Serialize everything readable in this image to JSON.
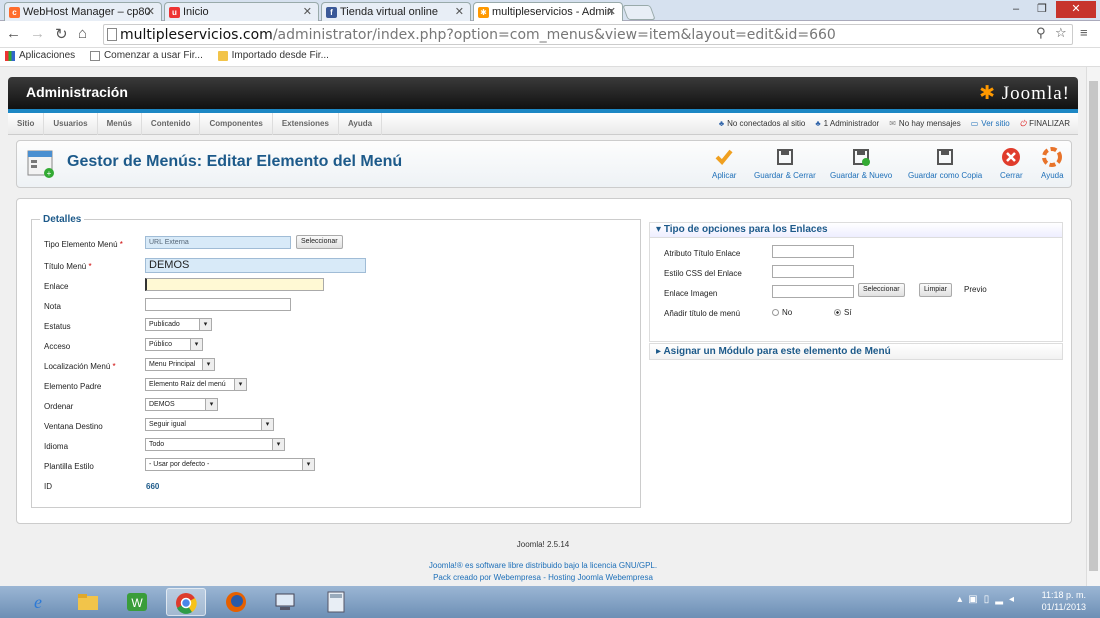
{
  "browser": {
    "tabs": [
      {
        "label": "WebHost Manager – cp80",
        "icon": "cpanel-icon"
      },
      {
        "label": "Inicio",
        "icon": "home-favicon"
      },
      {
        "label": "Tienda virtual online",
        "icon": "facebook-icon"
      },
      {
        "label": "multipleservicios - Admin",
        "icon": "joomla-icon",
        "active": true
      }
    ],
    "url_host": "multipleservicios.com",
    "url_path": "/administrator/index.php?option=com_menus&view=item&layout=edit&id=660",
    "bookmarks": [
      "Aplicaciones",
      "Comenzar a usar Fir...",
      "Importado desde Fir..."
    ]
  },
  "admin": {
    "header_title": "Administración",
    "brand": "Joomla!",
    "menu": [
      "Sitio",
      "Usuarios",
      "Menús",
      "Contenido",
      "Componentes",
      "Extensiones",
      "Ayuda"
    ],
    "status": {
      "visitors": "No conectados al sitio",
      "admins": "1 Administrador",
      "messages": "No hay mensajes",
      "view_site": "Ver sitio",
      "logout": "FINALIZAR"
    }
  },
  "toolbar": {
    "page_title": "Gestor de Menús: Editar Elemento del Menú",
    "buttons": [
      "Aplicar",
      "Guardar & Cerrar",
      "Guardar & Nuevo",
      "Guardar como Copia",
      "Cerrar",
      "Ayuda"
    ]
  },
  "form": {
    "legend": "Detalles",
    "fields": {
      "tipo_label": "Tipo Elemento Menú",
      "tipo_value": "URL Externa",
      "tipo_button": "Seleccionar",
      "titulo_label": "Título Menú",
      "titulo_value": "DEMOS",
      "enlace_label": "Enlace",
      "enlace_value": "",
      "nota_label": "Nota",
      "nota_value": "",
      "estatus_label": "Estatus",
      "estatus_value": "Publicado",
      "acceso_label": "Acceso",
      "acceso_value": "Público",
      "localizacion_label": "Localización Menú",
      "localizacion_value": "Menu Principal",
      "padre_label": "Elemento Padre",
      "padre_value": "Elemento Raíz del menú",
      "ordenar_label": "Ordenar",
      "ordenar_value": "DEMOS",
      "ventana_label": "Ventana Destino",
      "ventana_value": "Seguir igual",
      "idioma_label": "Idioma",
      "idioma_value": "Todo",
      "plantilla_label": "Plantilla Estilo",
      "plantilla_value": "- Usar por defecto -",
      "id_label": "ID",
      "id_value": "660"
    }
  },
  "link_options": {
    "header": "Tipo de opciones para los Enlaces",
    "atributo_label": "Atributo Título Enlace",
    "css_label": "Estilo CSS del Enlace",
    "imagen_label": "Enlace Imagen",
    "seleccionar": "Seleccionar",
    "limpiar": "Limpiar",
    "previo": "Previo",
    "anadir_label": "Añadir título de menú",
    "no": "No",
    "si": "Sí",
    "selected": "Sí"
  },
  "module_panel": {
    "header": "Asignar un Módulo para este elemento de Menú"
  },
  "footer": {
    "version": "Joomla! 2.5.14",
    "license": "Joomla!® es software libre distribuido bajo la licencia GNU/GPL.",
    "credit": "Pack creado por Webempresa - Hosting Joomla Webempresa"
  },
  "taskbar": {
    "time": "11:18 p. m.",
    "date": "01/11/2013"
  },
  "colors": {
    "accent": "#1d87c4",
    "title": "#1d5a8a",
    "required": "#cc0000",
    "taskbar": "#7d9bc0"
  }
}
